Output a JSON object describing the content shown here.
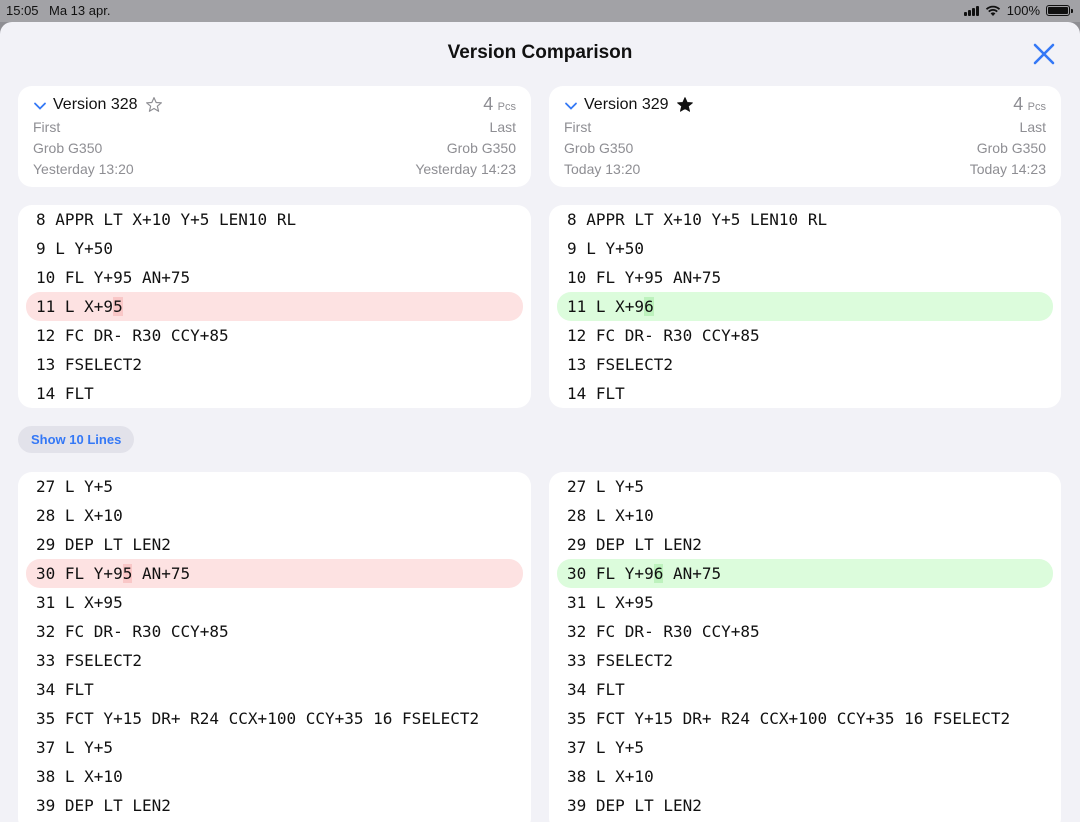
{
  "status_bar": {
    "time": "15:05",
    "date": "Ma 13 apr.",
    "battery": "100%"
  },
  "sheet": {
    "title": "Version Comparison",
    "close_icon": "close-x-icon",
    "accent_color": "#3478f6"
  },
  "left_version": {
    "title": "Version 328",
    "starred": false,
    "count": "4",
    "count_unit": "Pcs",
    "first_label": "First",
    "last_label": "Last",
    "first_machine": "Grob G350",
    "last_machine": "Grob G350",
    "first_time": "Yesterday 13:20",
    "last_time": "Yesterday 14:23"
  },
  "right_version": {
    "title": "Version 329",
    "starred": true,
    "count": "4",
    "count_unit": "Pcs",
    "first_label": "First",
    "last_label": "Last",
    "first_machine": "Grob G350",
    "last_machine": "Grob G350",
    "first_time": "Today 13:20",
    "last_time": "Today 14:23"
  },
  "show_lines_label": "Show 10 Lines",
  "diff_blocks": [
    {
      "left": [
        {
          "pre": "8 APPR LT X+10 Y+5 LEN10 RL"
        },
        {
          "pre": "9 L Y+50"
        },
        {
          "pre": "10 FL Y+95 AN+75"
        },
        {
          "pre": "11 L X+9",
          "hl": "5",
          "post": "",
          "type": "del"
        },
        {
          "pre": "12 FC DR- R30 CCY+85"
        },
        {
          "pre": "13 FSELECT2"
        },
        {
          "pre": "14 FLT"
        }
      ],
      "right": [
        {
          "pre": "8 APPR LT X+10 Y+5 LEN10 RL"
        },
        {
          "pre": "9 L Y+50"
        },
        {
          "pre": "10 FL Y+95 AN+75"
        },
        {
          "pre": "11 L X+9",
          "hl": "6",
          "post": "",
          "type": "add"
        },
        {
          "pre": "12 FC DR- R30 CCY+85"
        },
        {
          "pre": "13 FSELECT2"
        },
        {
          "pre": "14 FLT"
        }
      ]
    },
    {
      "left": [
        {
          "pre": "27 L Y+5"
        },
        {
          "pre": "28 L X+10"
        },
        {
          "pre": "29 DEP LT LEN2"
        },
        {
          "pre": "30 FL Y+9",
          "hl": "5",
          "post": " AN+75",
          "type": "del"
        },
        {
          "pre": "31 L X+95"
        },
        {
          "pre": "32 FC DR- R30 CCY+85"
        },
        {
          "pre": "33 FSELECT2"
        },
        {
          "pre": "34 FLT"
        },
        {
          "pre": "35 FCT Y+15 DR+ R24 CCX+100 CCY+35 16 FSELECT2"
        },
        {
          "pre": "37 L Y+5"
        },
        {
          "pre": "38 L X+10"
        },
        {
          "pre": "39 DEP LT LEN2"
        }
      ],
      "right": [
        {
          "pre": "27 L Y+5"
        },
        {
          "pre": "28 L X+10"
        },
        {
          "pre": "29 DEP LT LEN2"
        },
        {
          "pre": "30 FL Y+9",
          "hl": "6",
          "post": " AN+75",
          "type": "add"
        },
        {
          "pre": "31 L X+95"
        },
        {
          "pre": "32 FC DR- R30 CCY+85"
        },
        {
          "pre": "33 FSELECT2"
        },
        {
          "pre": "34 FLT"
        },
        {
          "pre": "35 FCT Y+15 DR+ R24 CCX+100 CCY+35 16 FSELECT2"
        },
        {
          "pre": "37 L Y+5"
        },
        {
          "pre": "38 L X+10"
        },
        {
          "pre": "39 DEP LT LEN2"
        }
      ]
    }
  ]
}
